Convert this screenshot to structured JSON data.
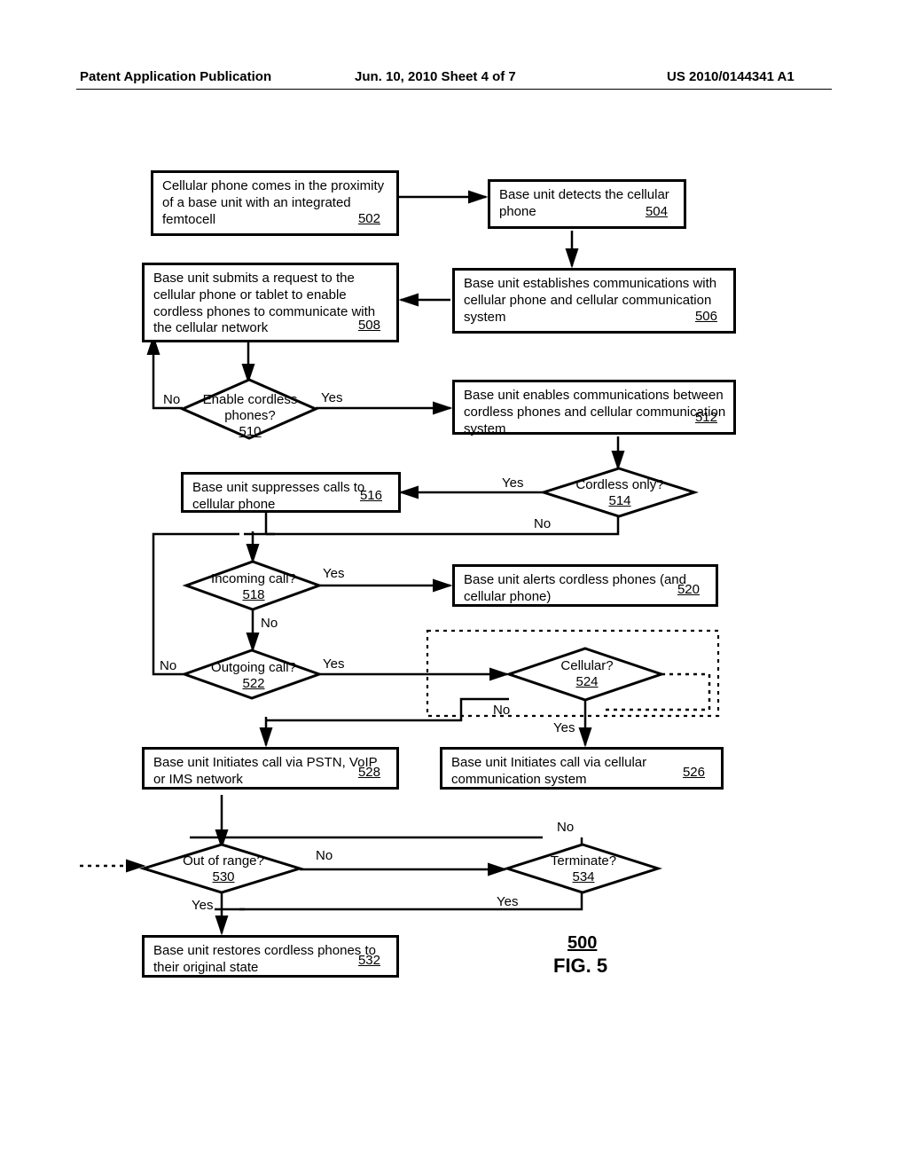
{
  "header": {
    "left": "Patent Application Publication",
    "mid": "Jun. 10, 2010  Sheet 4 of 7",
    "right": "US 2010/0144341 A1"
  },
  "boxes": {
    "b502": {
      "text": "Cellular phone comes in the proximity of a base unit with an integrated femtocell",
      "ref": "502"
    },
    "b504": {
      "text": "Base unit detects the cellular phone",
      "ref": "504"
    },
    "b506": {
      "text": "Base unit establishes communications with cellular phone and cellular communication system",
      "ref": "506"
    },
    "b508": {
      "text": "Base unit submits a request to the cellular phone or tablet to enable cordless phones to communicate with the cellular network",
      "ref": "508"
    },
    "b512": {
      "text": "Base unit enables communications between cordless phones and cellular communication system",
      "ref": "512"
    },
    "b516": {
      "text": "Base unit suppresses calls to cellular phone",
      "ref": "516"
    },
    "b520": {
      "text": "Base unit alerts cordless phones (and cellular phone)",
      "ref": "520"
    },
    "b526": {
      "text": "Base unit Initiates call via cellular communication system",
      "ref": "526"
    },
    "b528": {
      "text": "Base unit Initiates call via PSTN, VoIP or IMS network",
      "ref": "528"
    },
    "b532": {
      "text": "Base unit restores cordless phones to their original state",
      "ref": "532"
    }
  },
  "diamonds": {
    "d510": {
      "label": "Enable cordless phones?",
      "ref": "510"
    },
    "d514": {
      "label": "Cordless only?",
      "ref": "514"
    },
    "d518": {
      "label": "Incoming call?",
      "ref": "518"
    },
    "d522": {
      "label": "Outgoing call?",
      "ref": "522"
    },
    "d524": {
      "label": "Cellular?",
      "ref": "524"
    },
    "d530": {
      "label": "Out of range?",
      "ref": "530"
    },
    "d534": {
      "label": "Terminate?",
      "ref": "534"
    }
  },
  "labels": {
    "yes": "Yes",
    "no": "No"
  },
  "figure": {
    "ref": "500",
    "name": "FIG. 5"
  }
}
